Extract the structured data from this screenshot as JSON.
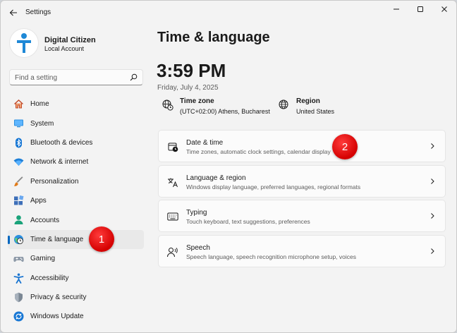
{
  "window": {
    "title": "Settings"
  },
  "profile": {
    "name": "Digital Citizen",
    "account_type": "Local Account"
  },
  "search": {
    "placeholder": "Find a setting"
  },
  "sidebar": {
    "items": [
      {
        "label": "Home",
        "icon": "home-icon",
        "selected": false
      },
      {
        "label": "System",
        "icon": "system-icon",
        "selected": false
      },
      {
        "label": "Bluetooth & devices",
        "icon": "bluetooth-icon",
        "selected": false
      },
      {
        "label": "Network & internet",
        "icon": "wifi-icon",
        "selected": false
      },
      {
        "label": "Personalization",
        "icon": "brush-icon",
        "selected": false
      },
      {
        "label": "Apps",
        "icon": "apps-icon",
        "selected": false
      },
      {
        "label": "Accounts",
        "icon": "accounts-icon",
        "selected": false
      },
      {
        "label": "Time & language",
        "icon": "time-language-icon",
        "selected": true
      },
      {
        "label": "Gaming",
        "icon": "gamepad-icon",
        "selected": false
      },
      {
        "label": "Accessibility",
        "icon": "accessibility-icon",
        "selected": false
      },
      {
        "label": "Privacy & security",
        "icon": "shield-icon",
        "selected": false
      },
      {
        "label": "Windows Update",
        "icon": "update-icon",
        "selected": false
      }
    ]
  },
  "main": {
    "title": "Time & language",
    "time": "3:59 PM",
    "date": "Friday, July 4, 2025",
    "timezone": {
      "title": "Time zone",
      "value": "(UTC+02:00) Athens, Bucharest"
    },
    "region": {
      "title": "Region",
      "value": "United States"
    },
    "cards": [
      {
        "title": "Date & time",
        "subtitle": "Time zones, automatic clock settings, calendar display",
        "icon": "date-time-icon"
      },
      {
        "title": "Language & region",
        "subtitle": "Windows display language, preferred languages, regional formats",
        "icon": "language-icon"
      },
      {
        "title": "Typing",
        "subtitle": "Touch keyboard, text suggestions, preferences",
        "icon": "keyboard-icon"
      },
      {
        "title": "Speech",
        "subtitle": "Speech language, speech recognition microphone setup, voices",
        "icon": "speech-icon"
      }
    ]
  },
  "markers": {
    "one": "1",
    "two": "2"
  },
  "colors": {
    "accent": "#0067c0",
    "marker": "#e00000",
    "window_bg": "#f3f3f3",
    "card_bg": "#fbfbfb"
  }
}
